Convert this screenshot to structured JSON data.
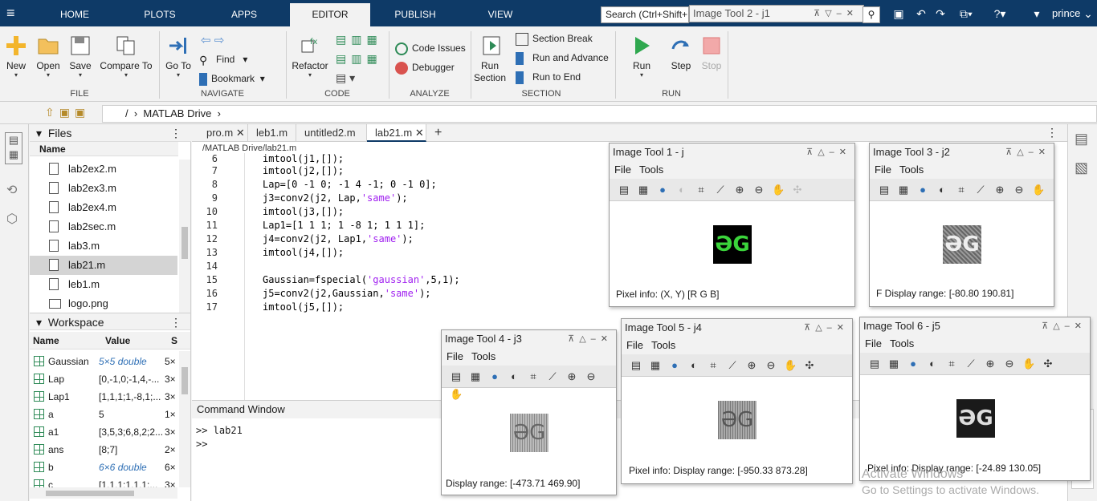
{
  "topbar": {
    "tabs": [
      "HOME",
      "PLOTS",
      "APPS",
      "EDITOR",
      "PUBLISH",
      "VIEW"
    ],
    "active_tab": "EDITOR",
    "search_placeholder": "Search (Ctrl+Shift+",
    "floating_title": "Image Tool 2 - j1",
    "user": "prince"
  },
  "ribbon": {
    "file": {
      "new": "New",
      "open": "Open",
      "save": "Save",
      "compare": "Compare To",
      "group": "FILE"
    },
    "navigate": {
      "goto": "Go To",
      "find": "Find",
      "bookmark": "Bookmark",
      "group": "NAVIGATE"
    },
    "code": {
      "refactor": "Refactor",
      "group": "CODE"
    },
    "analyze": {
      "code_issues": "Code Issues",
      "debugger": "Debugger",
      "group": "ANALYZE"
    },
    "section": {
      "run_section": "Run Section",
      "section_break": "Section Break",
      "run_advance": "Run and Advance",
      "run_end": "Run to End",
      "group": "SECTION"
    },
    "run": {
      "run": "Run",
      "step": "Step",
      "stop": "Stop",
      "group": "RUN"
    }
  },
  "address": {
    "sep": "/",
    "crumb": "MATLAB Drive"
  },
  "files": {
    "title": "Files",
    "col": "Name",
    "items": [
      "lab2ex2.m",
      "lab2ex3.m",
      "lab2ex4.m",
      "lab2sec.m",
      "lab3.m",
      "lab21.m",
      "leb1.m",
      "logo.png"
    ],
    "selected": "lab21.m"
  },
  "workspace": {
    "title": "Workspace",
    "cols": [
      "Name",
      "Value",
      "S"
    ],
    "rows": [
      {
        "name": "Gaussian",
        "value": "5×5 double",
        "size": "5×"
      },
      {
        "name": "Lap",
        "value": "[0,-1,0;-1,4,-...",
        "size": "3×"
      },
      {
        "name": "Lap1",
        "value": "[1,1,1;1,-8,1;...",
        "size": "3×"
      },
      {
        "name": "a",
        "value": "5",
        "size": "1×"
      },
      {
        "name": "a1",
        "value": "[3,5,3;6,8,2;2...",
        "size": "3×"
      },
      {
        "name": "ans",
        "value": "[8;7]",
        "size": "2×"
      },
      {
        "name": "b",
        "value": "6×6 double",
        "size": "6×"
      },
      {
        "name": "c",
        "value": "[1,1,1;1,1,1;...",
        "size": "3×"
      }
    ]
  },
  "editor": {
    "tabs": [
      "pro.m",
      "leb1.m",
      "untitled2.m",
      "lab21.m"
    ],
    "active": "lab21.m",
    "path": "/MATLAB Drive/lab21.m",
    "lines": [
      {
        "n": "6",
        "t": "imtool(j1,[]);"
      },
      {
        "n": "7",
        "t": "imtool(j2,[]);"
      },
      {
        "n": "8",
        "t": "Lap=[0 -1 0; -1 4 -1; 0 -1 0];"
      },
      {
        "n": "9",
        "t": "j3=conv2(j2, Lap,'same');"
      },
      {
        "n": "10",
        "t": "imtool(j3,[]);"
      },
      {
        "n": "11",
        "t": "Lap1=[1 1 1; 1 -8 1; 1 1 1];"
      },
      {
        "n": "12",
        "t": "j4=conv2(j2, Lap1,'same');"
      },
      {
        "n": "13",
        "t": "imtool(j4,[]);"
      },
      {
        "n": "14",
        "t": ""
      },
      {
        "n": "15",
        "t": "Gaussian=fspecial('gaussian',5,1);"
      },
      {
        "n": "16",
        "t": "j5=conv2(j2,Gaussian,'same');"
      },
      {
        "n": "17",
        "t": "imtool(j5,[]);"
      }
    ]
  },
  "command": {
    "title": "Command Window",
    "line1": ">> lab21",
    "line2": ">>"
  },
  "menus": {
    "file": "File",
    "tools": "Tools"
  },
  "tools": [
    {
      "title": "Image Tool 1 - j",
      "info": "Pixel info:  (X, Y)  [R G B]"
    },
    {
      "title": "Image Tool 3 - j2",
      "info": "F   Display range:    [-80.80 190.81]"
    },
    {
      "title": "Image Tool 4 - j3",
      "info": "Display range:     [-473.71 469.90]"
    },
    {
      "title": "Image Tool 5 - j4",
      "info": "Pixel info:    Display range:    [-950.33 873.28]"
    },
    {
      "title": "Image Tool 6 - j5",
      "info": "Pixel info:    Display range:    [-24.89 130.05]"
    }
  ],
  "glyph": {
    "g1": "ƏG"
  },
  "watermark": {
    "line1": "Activate Windows",
    "line2": "Go to Settings to activate Windows."
  }
}
